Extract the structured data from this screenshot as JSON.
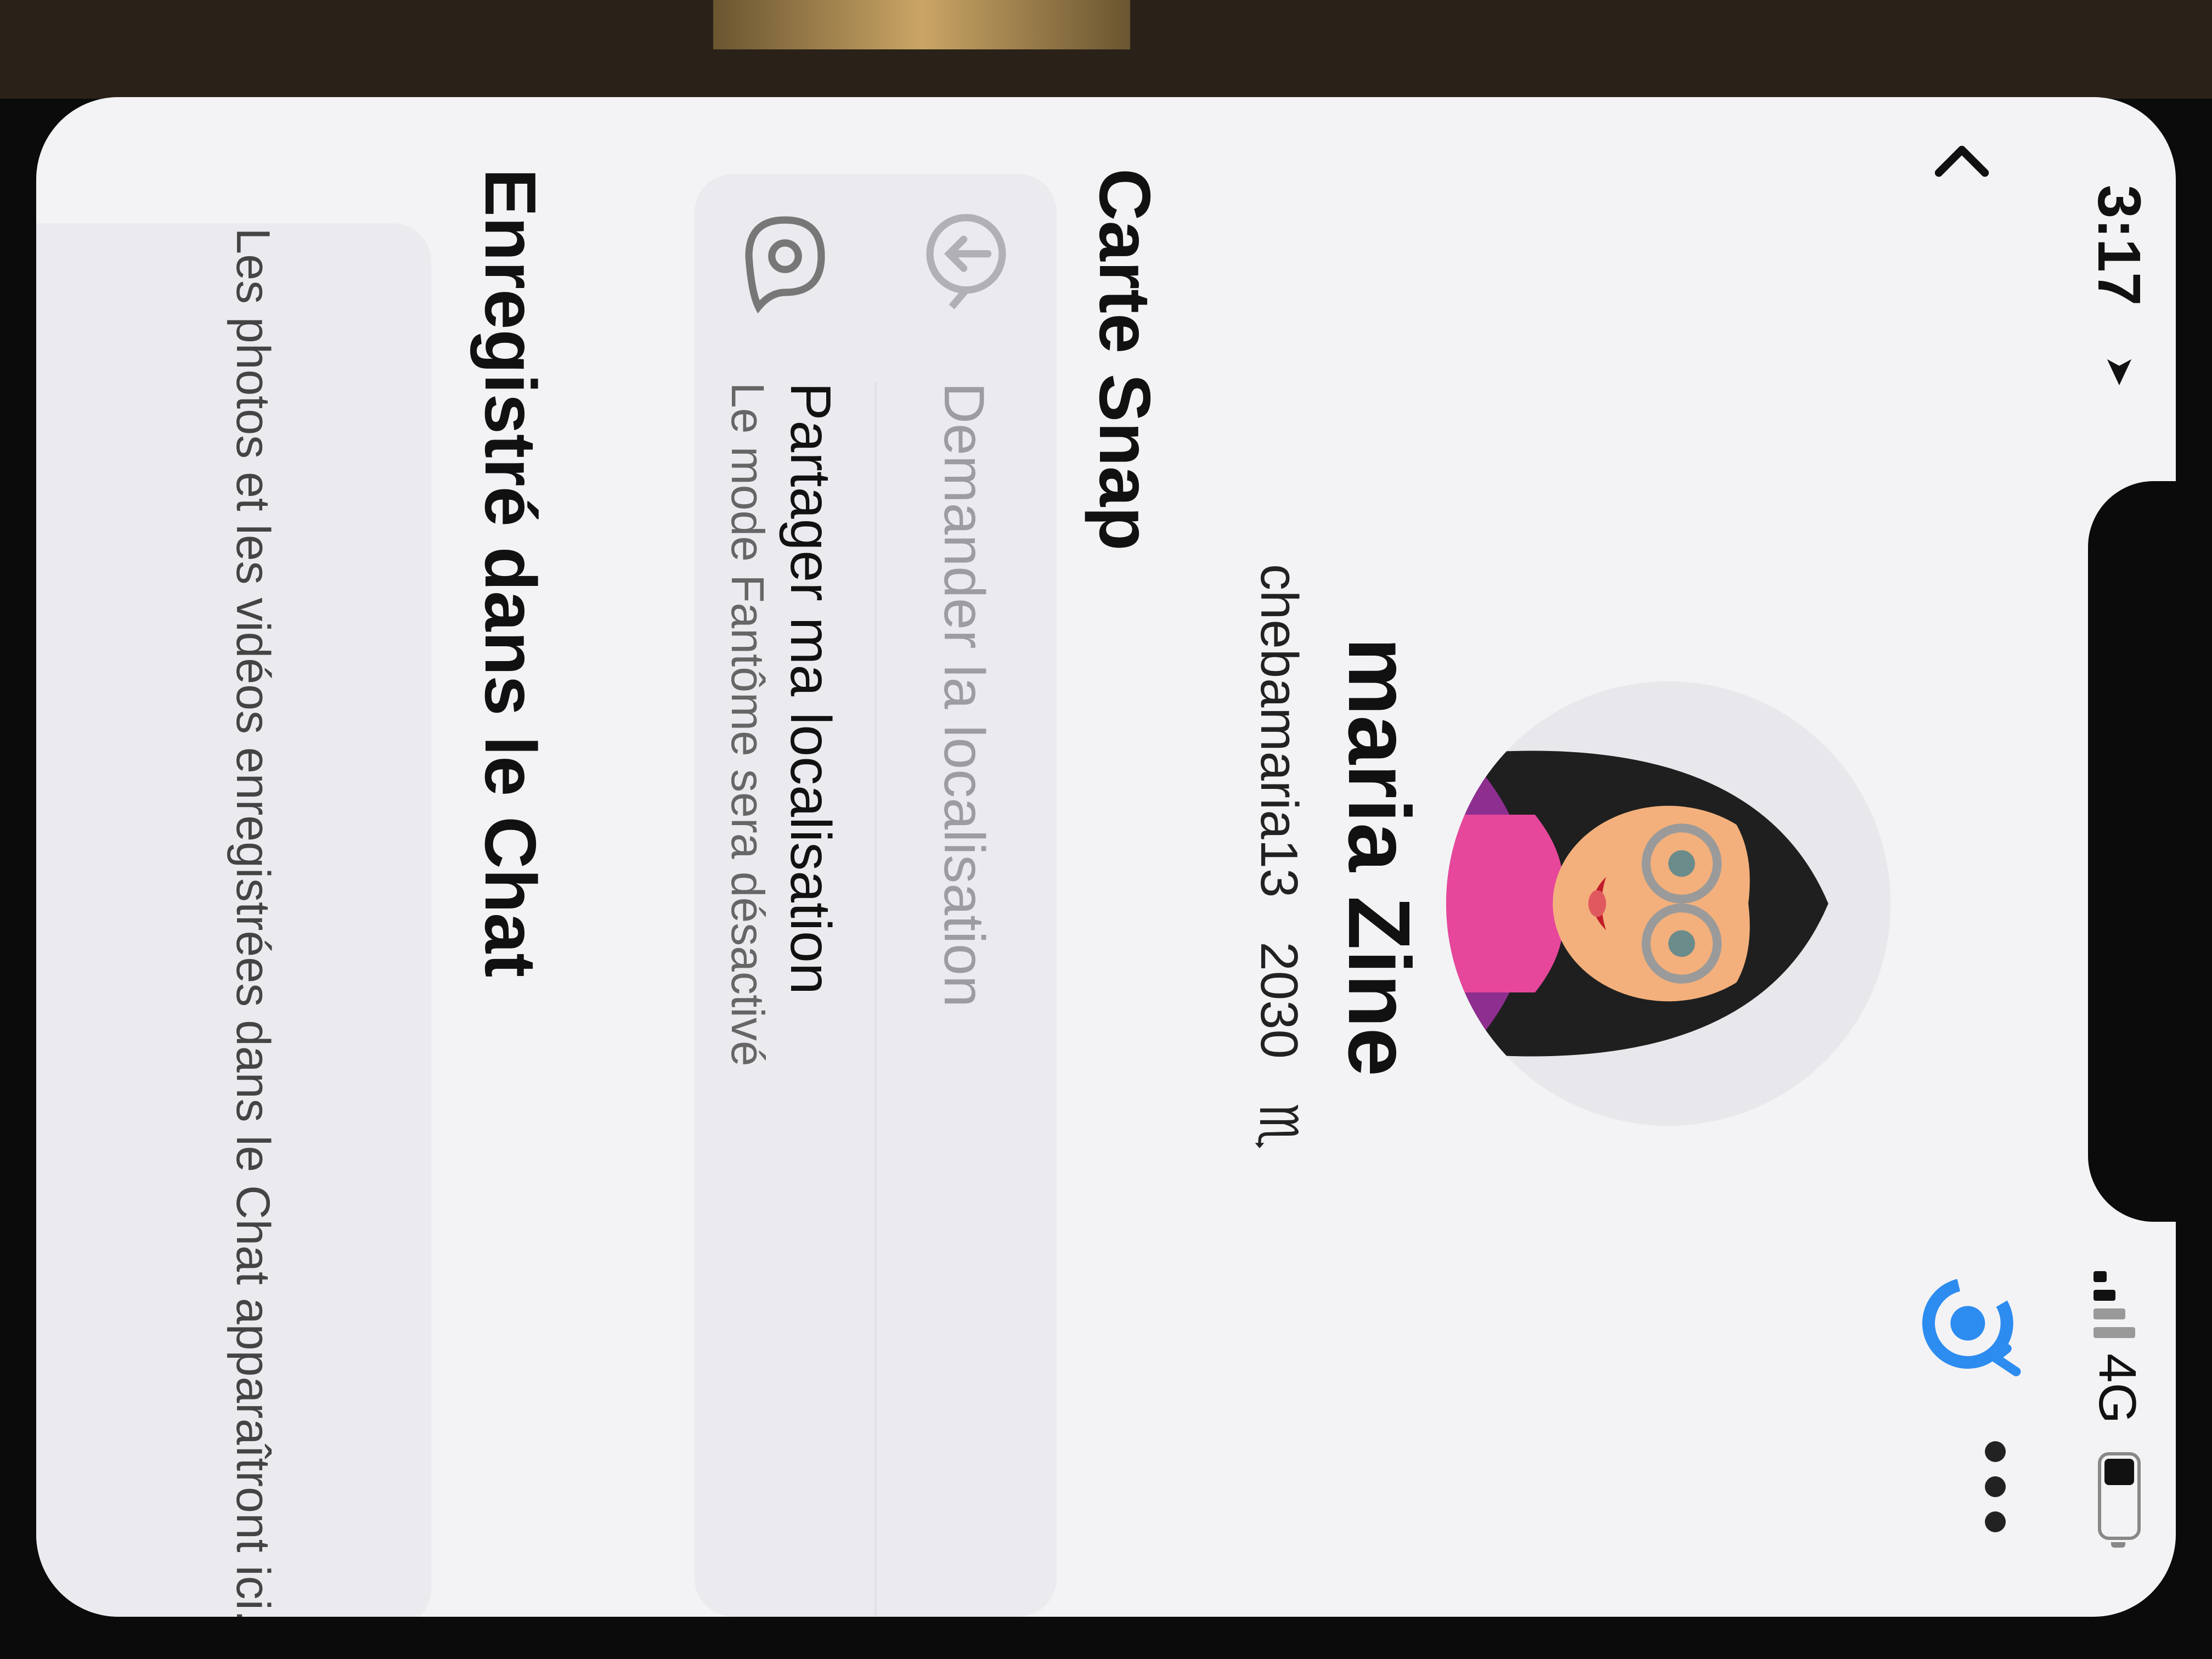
{
  "status_bar": {
    "time": "3:17",
    "network": "4G",
    "battery_level": 0.35
  },
  "profile": {
    "display_name": "maria Zine",
    "username": "chebamaria13",
    "snap_score": "2030",
    "zodiac_symbol": "♏"
  },
  "snap_map": {
    "title": "Carte Snap",
    "items": [
      {
        "label": "Demander la localisation",
        "subtitle": "",
        "icon": "request-location-icon",
        "enabled": false
      },
      {
        "label": "Partager ma localisation",
        "subtitle": "Le mode Fantôme sera désactivé",
        "icon": "location-pin-icon",
        "enabled": true
      }
    ]
  },
  "saved_in_chat": {
    "title": "Enregistré dans le Chat",
    "empty_message": "Les photos et les vidéos enregistrées dans le Chat apparaîtront ici."
  },
  "colors": {
    "accent": "#2d8cf0",
    "background": "#f3f3f5",
    "card": "#ebebef"
  }
}
